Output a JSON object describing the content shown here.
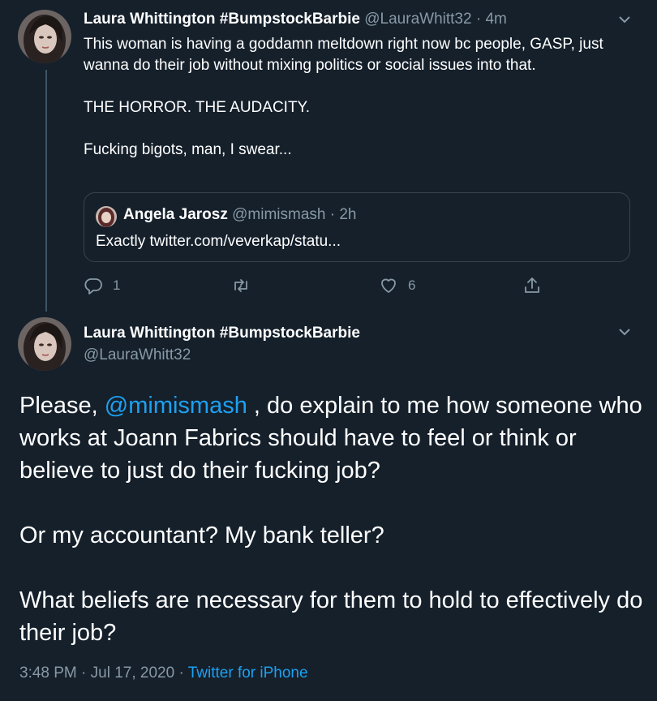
{
  "tweet1": {
    "author_name": "Laura Whittington #BumpstockBarbie",
    "author_handle": "@LauraWhitt32",
    "time": "4m",
    "body": "This woman is having a goddamn meltdown right now bc people, GASP, just wanna do their job without mixing politics or social issues into that.\n\nTHE HORROR. THE AUDACITY.\n\nFucking bigots, man, I swear...",
    "quote": {
      "author_name": "Angela Jarosz",
      "author_handle": "@mimismash",
      "time": "2h",
      "text": "Exactly twitter.com/veverkap/statu..."
    },
    "actions": {
      "reply_icon": "reply-icon",
      "reply_count": "1",
      "retweet_icon": "retweet-icon",
      "like_icon": "heart-icon",
      "like_count": "6",
      "share_icon": "share-icon"
    }
  },
  "tweet2": {
    "author_name": "Laura Whittington #BumpstockBarbie",
    "author_handle": "@LauraWhitt32",
    "body_p1_before": "Please, ",
    "body_p1_mention": "@mimismash",
    "body_p1_after": " , do explain to me how someone who works at Joann Fabrics should have to feel or think or believe to just do their fucking job?",
    "body_p2": "Or my accountant? My bank teller?",
    "body_p3": "What beliefs are necessary for them to hold to effectively do their job?",
    "timestamp": "3:48 PM · Jul 17, 2020",
    "separator": "·",
    "source": "Twitter for iPhone"
  },
  "colors": {
    "background": "#15202b",
    "accent": "#1da1f2",
    "secondary_text": "#8899a6",
    "border": "#38444d"
  }
}
